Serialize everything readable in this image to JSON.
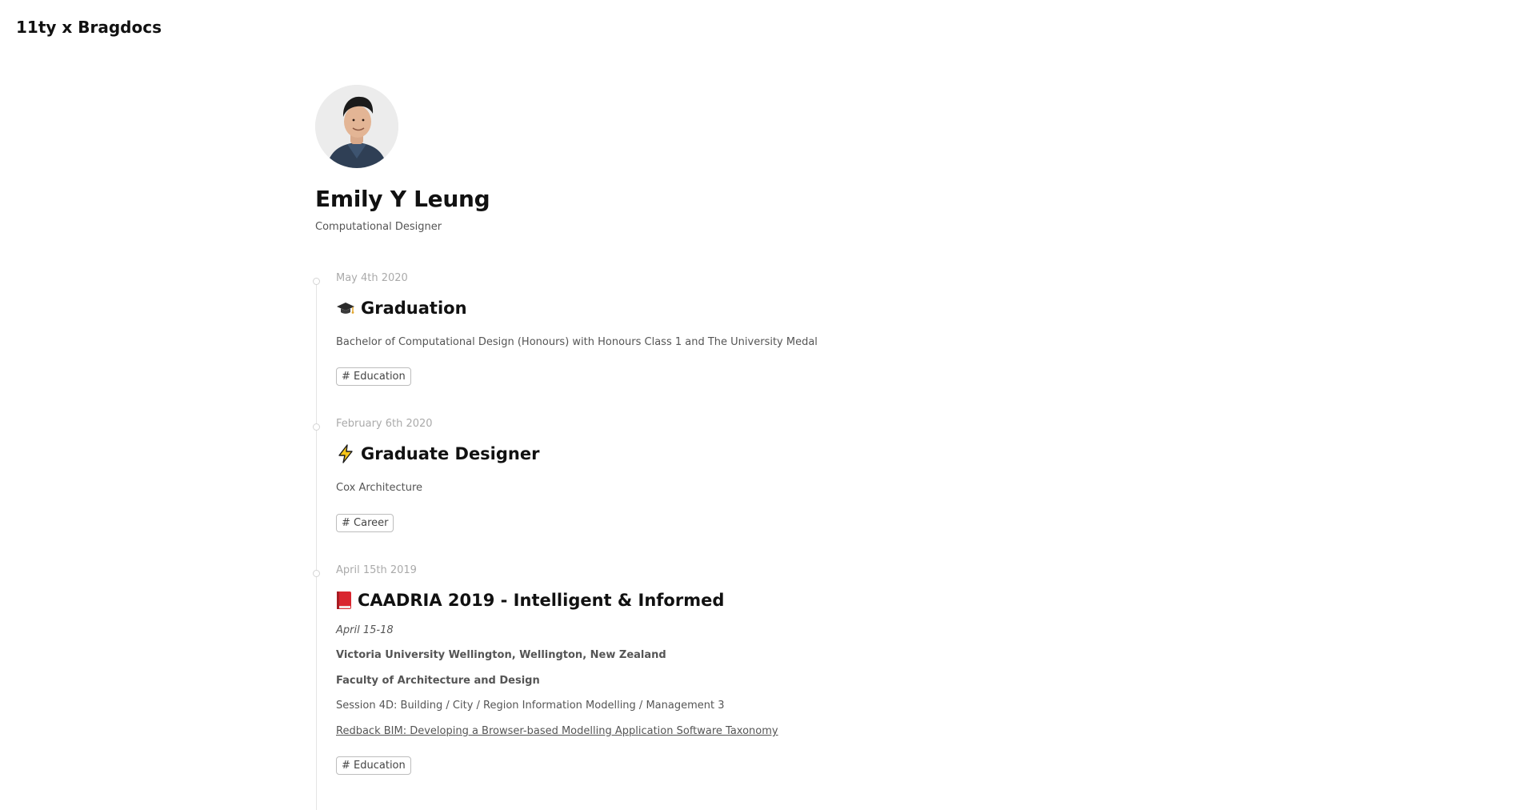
{
  "header": {
    "site_title": "11ty x Bragdocs"
  },
  "profile": {
    "name": "Emily Y Leung",
    "role": "Computational Designer"
  },
  "entries": [
    {
      "date": "May 4th 2020",
      "icon": "graduation-cap-icon",
      "title": "Graduation",
      "lines": [
        "Bachelor of Computational Design (Honours) with Honours Class 1 and The University Medal"
      ],
      "tag": "# Education"
    },
    {
      "date": "February 6th 2020",
      "icon": "lightning-icon",
      "title": "Graduate Designer",
      "lines": [
        "Cox Architecture"
      ],
      "tag": "# Career"
    },
    {
      "date": "April 15th 2019",
      "icon": "red-book-icon",
      "title": "CAADRIA 2019 - Intelligent & Informed",
      "lines": [
        "April 15-18",
        "Victoria University Wellington, Wellington, New Zealand",
        "Faculty of Architecture and Design",
        "Session 4D: Building / City / Region Information Modelling / Management 3",
        "Redback BIM: Developing a Browser-based Modelling Application Software Taxonomy"
      ],
      "tag": "# Education"
    }
  ]
}
